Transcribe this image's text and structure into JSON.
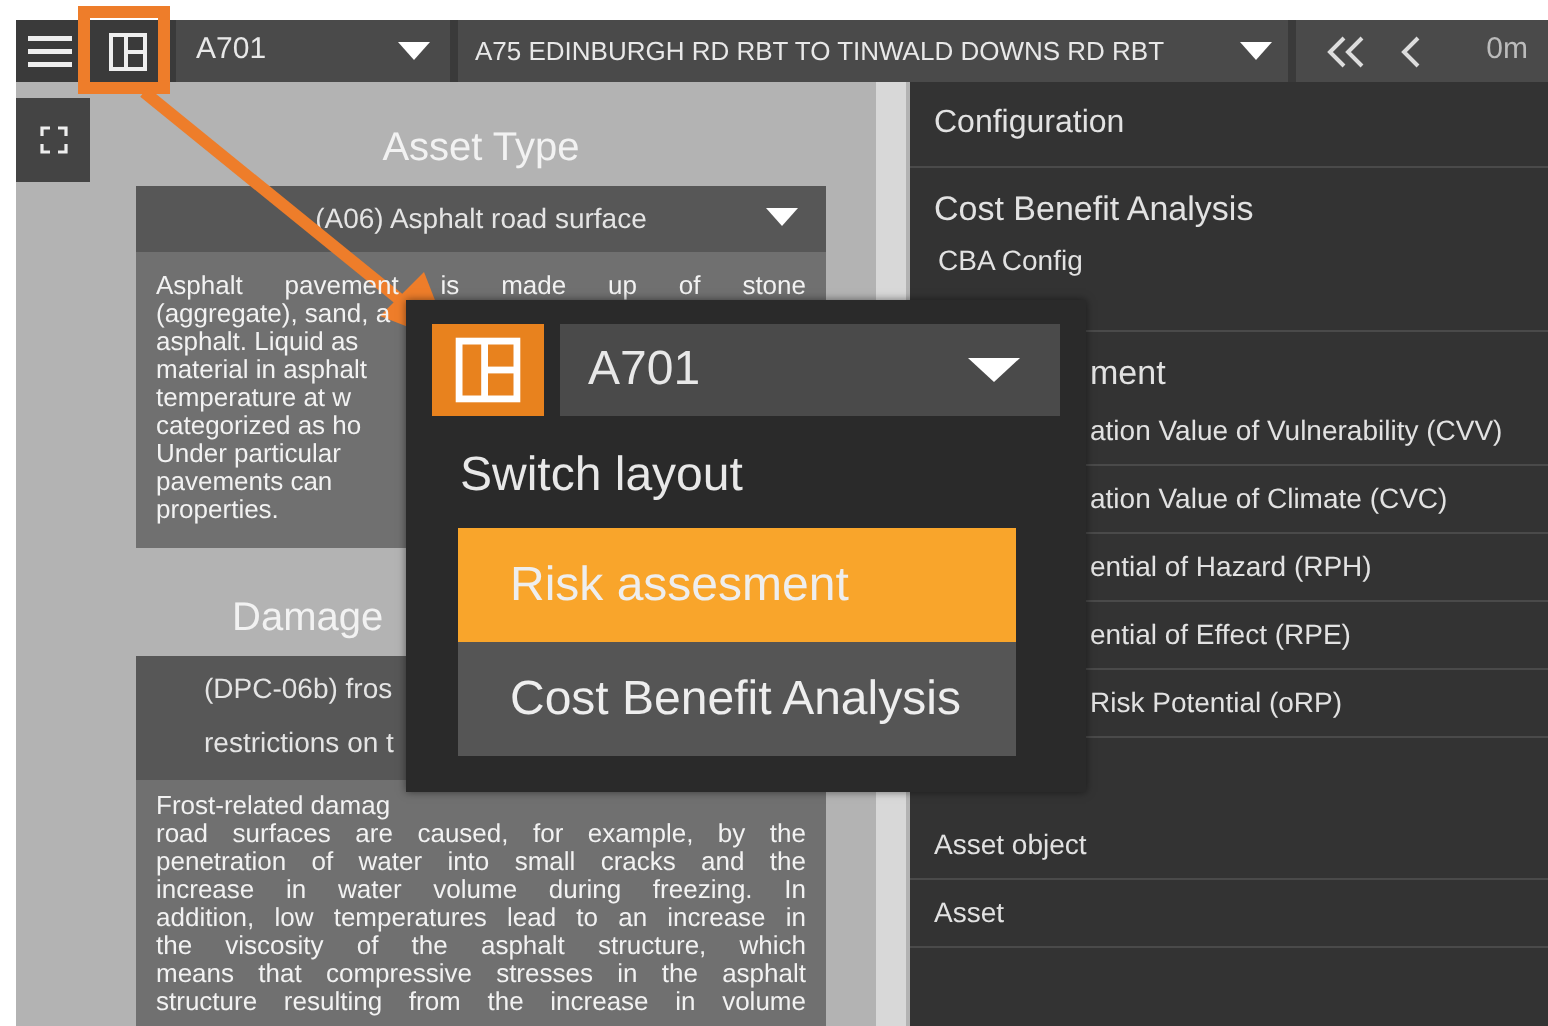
{
  "topbar": {
    "road": "A701",
    "section": "A75 EDINBURGH RD RBT TO TINWALD DOWNS RD RBT",
    "distance": "0m"
  },
  "left_panel": {
    "sections": [
      {
        "title": "Asset Type",
        "select_lines": [
          "(A06) Asphalt road surface"
        ],
        "description_lines": [
          "Asphalt pavement is made up of stone",
          "(aggregate), sand, a",
          "asphalt. Liquid as",
          "material in asphalt",
          "temperature at w",
          "categorized as ho",
          "Under particular",
          "pavements can",
          "properties."
        ]
      },
      {
        "title": "Damage",
        "select_lines": [
          "(DPC-06b) fros",
          "restrictions on t"
        ],
        "description_lines": [
          "Frost-related damag",
          "road surfaces are caused, for example, by the",
          "penetration of water into small cracks and the",
          "increase in water volume during freezing. In",
          "addition, low temperatures lead to an increase in",
          "the viscosity of the asphalt structure, which",
          "means that compressive stresses in the asphalt",
          "structure resulting from the increase in volume"
        ]
      }
    ]
  },
  "right_panel": {
    "rows": [
      {
        "kind": "header",
        "text": "Configuration",
        "partly_hidden": false
      },
      {
        "kind": "heading",
        "text": "Cost Benefit Analysis",
        "partly_hidden": false
      },
      {
        "kind": "sub",
        "text": "CBA Config",
        "partly_hidden": false
      },
      {
        "kind": "heading",
        "text": "ment",
        "partly_hidden": true
      },
      {
        "kind": "item",
        "text": "ation Value of Vulnerability (CVV)",
        "partly_hidden": true
      },
      {
        "kind": "item",
        "text": "ation Value of Climate (CVC)",
        "partly_hidden": true
      },
      {
        "kind": "item",
        "text": "ential of Hazard (RPH)",
        "partly_hidden": true
      },
      {
        "kind": "item",
        "text": "ential of Effect (RPE)",
        "partly_hidden": true
      },
      {
        "kind": "item",
        "text": "Risk Potential (oRP)",
        "partly_hidden": true
      },
      {
        "kind": "gap"
      },
      {
        "kind": "item",
        "text": "Asset object",
        "partly_hidden": false
      },
      {
        "kind": "item",
        "text": "Asset",
        "partly_hidden": false
      }
    ]
  },
  "popup": {
    "road": "A701",
    "title": "Switch layout",
    "options": [
      {
        "label": "Risk assesment",
        "selected": true
      },
      {
        "label": "Cost Benefit Analysis",
        "selected": false
      }
    ]
  }
}
